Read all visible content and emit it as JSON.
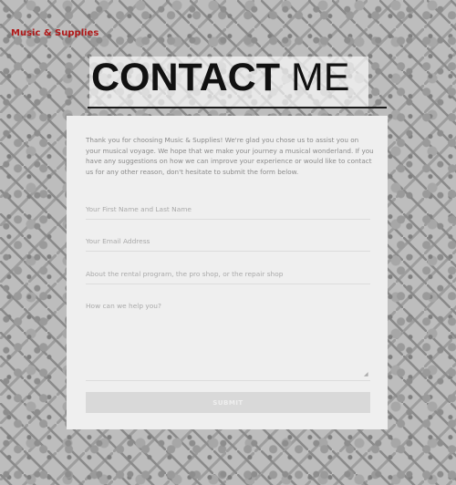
{
  "header": {
    "brand": "Music & Supplies"
  },
  "page": {
    "title_bold": "CONTACT",
    "title_light": "ME"
  },
  "form": {
    "intro": "Thank you for choosing Music & Supplies! We're glad you chose us to assist you on your musical voyage. We hope that we make your journey a musical wonderland. If you have any suggestions on how we can improve your experience or would like to contact us for any other reason, don't hesitate to submit the form below.",
    "name_placeholder": "Your First Name and Last Name",
    "name_value": "",
    "email_placeholder": "Your Email Address",
    "email_value": "",
    "topic_placeholder": "About the rental program, the pro shop, or the repair shop",
    "topic_value": "",
    "message_placeholder": "How can we help you?",
    "message_value": "",
    "submit_label": "SUBMIT"
  },
  "colors": {
    "brand": "#b01818",
    "card": "#efefef",
    "button": "#d9d9d9"
  }
}
